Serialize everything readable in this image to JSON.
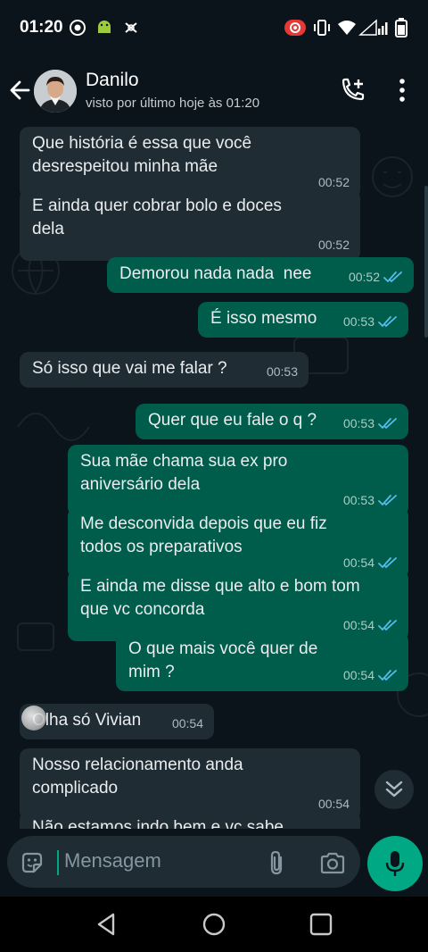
{
  "status_bar": {
    "time": "01:20"
  },
  "header": {
    "contact_name": "Danilo",
    "last_seen": "visto por último hoje às 01:20"
  },
  "messages": [
    {
      "dir": "in",
      "text": "Que história é essa que você\ndesrespeitou minha mãe",
      "time": "00:52"
    },
    {
      "dir": "in",
      "text": "E ainda quer cobrar bolo e doces\ndela",
      "time": "00:52"
    },
    {
      "dir": "out",
      "text": "Demorou nada nada  nee",
      "time": "00:52",
      "read": true
    },
    {
      "dir": "out",
      "text": "É isso mesmo",
      "time": "00:53",
      "read": true
    },
    {
      "dir": "in",
      "text": "Só isso que vai me falar ?",
      "time": "00:53"
    },
    {
      "dir": "out",
      "text": "Quer que eu fale o q ?",
      "time": "00:53",
      "read": true
    },
    {
      "dir": "out",
      "text": "Sua mãe chama sua ex pro\naniversário dela",
      "time": "00:53",
      "read": true
    },
    {
      "dir": "out",
      "text": "Me desconvida depois que eu fiz\ntodos os preparativos",
      "time": "00:54",
      "read": true
    },
    {
      "dir": "out",
      "text": "E ainda me disse que alto e bom tom\nque vc concorda",
      "time": "00:54",
      "read": true
    },
    {
      "dir": "out",
      "text": "O que mais você quer de mim ?",
      "time": "00:54",
      "read": true
    },
    {
      "dir": "in",
      "text": "Olha só Vivian",
      "time": "00:54"
    },
    {
      "dir": "in",
      "text": "Nosso relacionamento anda\ncomplicado",
      "time": "00:54"
    },
    {
      "dir": "in",
      "text": "Não estamos indo bem e vc sabe",
      "time": ""
    }
  ],
  "composer": {
    "placeholder": "Mensagem"
  },
  "colors": {
    "background": "#0b141a",
    "incoming_bubble": "#202c33",
    "outgoing_bubble": "#005c4b",
    "accent": "#00a884",
    "read_ticks": "#53bdeb"
  }
}
